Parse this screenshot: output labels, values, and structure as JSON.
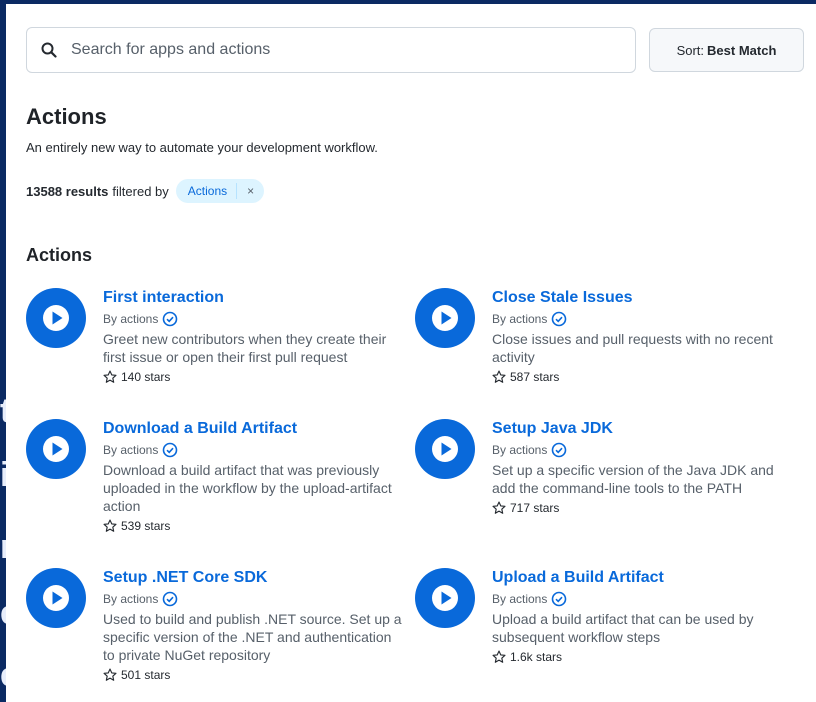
{
  "search": {
    "placeholder": "Search for apps and actions"
  },
  "sort": {
    "prefix": "Sort:",
    "value": "Best Match"
  },
  "header": {
    "title": "Actions",
    "subtitle": "An entirely new way to automate your development workflow."
  },
  "results": {
    "count": "13588 results",
    "filtered_text": "filtered by",
    "chip_label": "Actions",
    "chip_close": "×"
  },
  "section": {
    "title": "Actions"
  },
  "cards": [
    {
      "name": "First interaction",
      "by": "By actions",
      "description": "Greet new contributors when they create their first issue or open their first pull request",
      "stars": "140 stars"
    },
    {
      "name": "Close Stale Issues",
      "by": "By actions",
      "description": "Close issues and pull requests with no recent activity",
      "stars": "587 stars"
    },
    {
      "name": "Download a Build Artifact",
      "by": "By actions",
      "description": "Download a build artifact that was previously uploaded in the workflow by the upload-artifact action",
      "stars": "539 stars"
    },
    {
      "name": "Setup Java JDK",
      "by": "By actions",
      "description": "Set up a specific version of the Java JDK and add the command-line tools to the PATH",
      "stars": "717 stars"
    },
    {
      "name": "Setup .NET Core SDK",
      "by": "By actions",
      "description": "Used to build and publish .NET source. Set up a specific version of the .NET and authentication to private NuGet repository",
      "stars": "501 stars"
    },
    {
      "name": "Upload a Build Artifact",
      "by": "By actions",
      "description": "Upload a build artifact that can be used by subsequent workflow steps",
      "stars": "1.6k stars"
    }
  ],
  "colors": {
    "accent": "#0969da",
    "backdrop": "#0b2a63",
    "chip_bg": "#ddf4ff"
  },
  "icons": {
    "search": "search-icon",
    "play": "play-icon",
    "verified": "verified-check-icon",
    "star": "star-icon"
  }
}
